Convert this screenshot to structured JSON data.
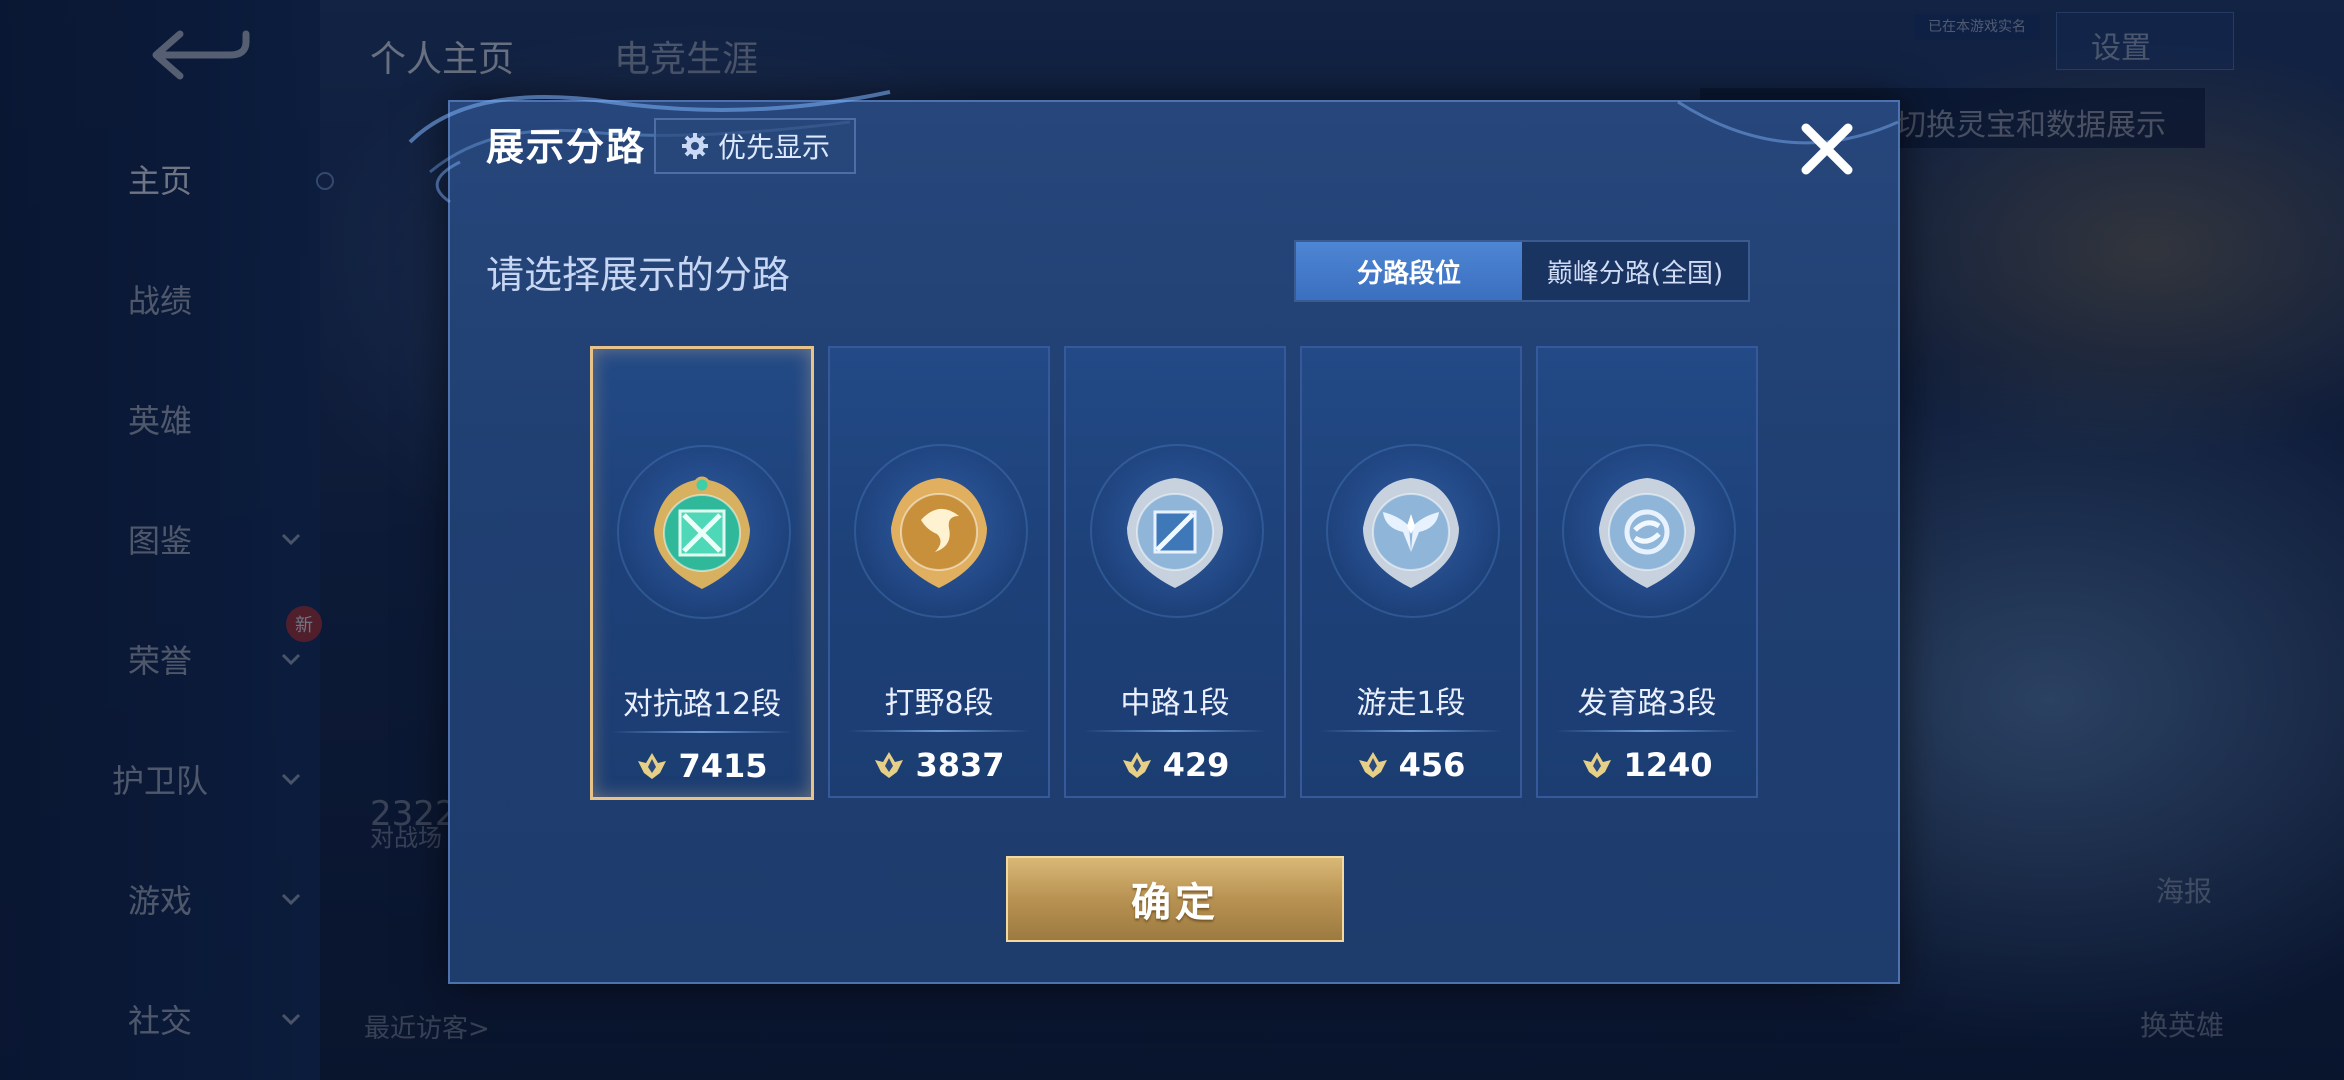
{
  "background": {
    "sidebar": {
      "items": [
        {
          "label": "主页",
          "chevron": false,
          "active": true
        },
        {
          "label": "战绩",
          "chevron": false
        },
        {
          "label": "英雄",
          "chevron": false
        },
        {
          "label": "图鉴",
          "chevron": true
        },
        {
          "label": "荣誉",
          "chevron": true
        },
        {
          "label": "护卫队",
          "chevron": true
        },
        {
          "label": "游戏",
          "chevron": true
        },
        {
          "label": "社交",
          "chevron": true
        }
      ],
      "new_badge": "新"
    },
    "top_tabs": [
      "个人主页",
      "电竞生涯"
    ],
    "settings_label": "设置",
    "tip_text": "切换灵宝和数据展示",
    "tiny_label": "已在本游戏实名",
    "visitors_label": "最近访客>",
    "poster_label": "海报",
    "change_hero_label": "换英雄",
    "count_text": "2322",
    "count_caption": "对战场"
  },
  "dialog": {
    "title": "展示分路",
    "priority_button": "优先显示",
    "subtitle": "请选择展示的分路",
    "segment": {
      "options": [
        "分路段位",
        "巅峰分路(全国)"
      ],
      "selected": 0
    },
    "cards": [
      {
        "name": "对抗路12段",
        "score": "7415",
        "selected": true,
        "emblem": "clash-lane-emblem-icon",
        "emblem_color": "#2fb89a"
      },
      {
        "name": "打野8段",
        "score": "3837",
        "selected": false,
        "emblem": "jungle-dragon-emblem-icon",
        "emblem_color": "#c8903a"
      },
      {
        "name": "中路1段",
        "score": "429",
        "selected": false,
        "emblem": "mid-lane-emblem-icon",
        "emblem_color": "#8fb6d8"
      },
      {
        "name": "游走1段",
        "score": "456",
        "selected": false,
        "emblem": "roam-wings-emblem-icon",
        "emblem_color": "#8fb6d8"
      },
      {
        "name": "发育路3段",
        "score": "1240",
        "selected": false,
        "emblem": "farm-lane-emblem-icon",
        "emblem_color": "#8fb6d8"
      }
    ],
    "confirm_button": "确定",
    "accent_gold": "#d9b876"
  }
}
